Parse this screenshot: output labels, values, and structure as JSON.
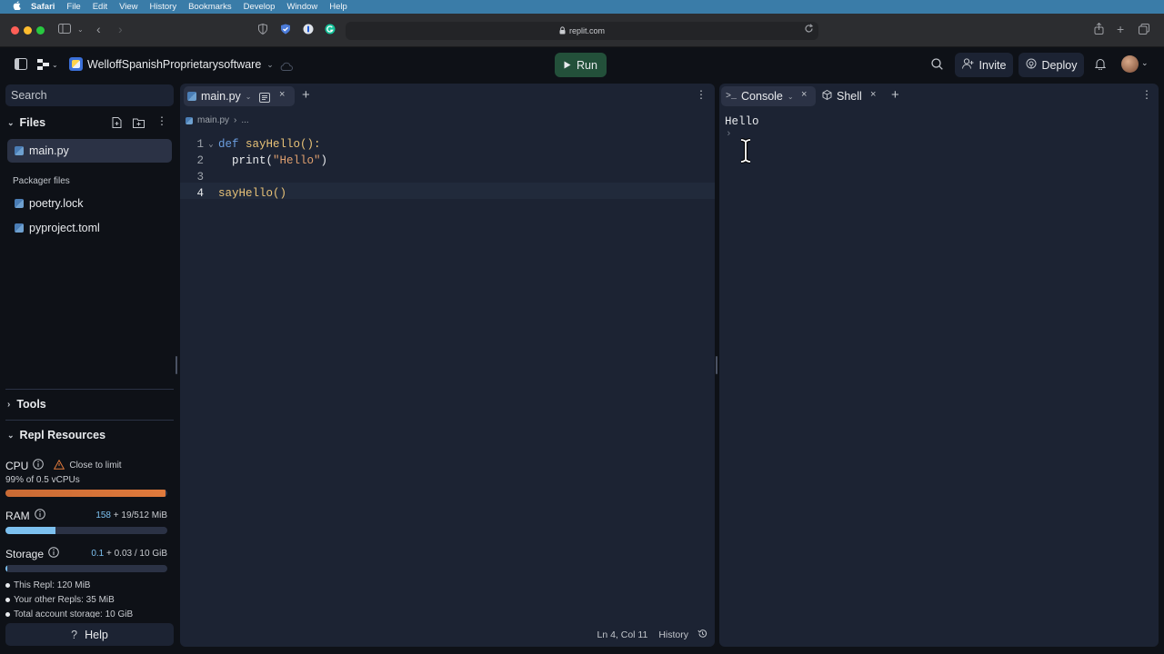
{
  "menubar": {
    "apple": "",
    "items": [
      "Safari",
      "File",
      "Edit",
      "View",
      "History",
      "Bookmarks",
      "Develop",
      "Window",
      "Help"
    ]
  },
  "browser": {
    "url": "replit.com"
  },
  "app": {
    "repl_name": "WelloffSpanishProprietarysoftware",
    "run_label": "Run",
    "invite_label": "Invite",
    "deploy_label": "Deploy"
  },
  "sidebar": {
    "search_placeholder": "Search",
    "files_title": "Files",
    "active_file": "main.py",
    "packager_title": "Packager files",
    "packager_files": [
      "poetry.lock",
      "pyproject.toml"
    ],
    "tools_title": "Tools",
    "resources_title": "Repl Resources",
    "cpu_label": "CPU",
    "cpu_warning": "Close to limit",
    "cpu_detail": "99% of 0.5 vCPUs",
    "cpu_fraction": 0.99,
    "ram_label": "RAM",
    "ram_used": "158",
    "ram_rest": "+ 19/512 MiB",
    "ram_fraction": 0.31,
    "storage_label": "Storage",
    "storage_used": "0.1",
    "storage_rest": "+ 0.03 / 10 GiB",
    "storage_fraction": 0.01,
    "storage_items": [
      "This Repl: 120 MiB",
      "Your other Repls: 35 MiB",
      "Total account storage: 10 GiB"
    ],
    "help_label": "Help"
  },
  "editor": {
    "tab_label": "main.py",
    "breadcrumb_file": "main.py",
    "breadcrumb_more": "...",
    "lines": [
      {
        "num": "1",
        "kw": "def",
        "rest": " sayHello():"
      },
      {
        "num": "2",
        "fn": "  print(",
        "str": "\"Hello\"",
        "end": ")"
      },
      {
        "num": "3",
        "text": ""
      },
      {
        "num": "4",
        "text": "sayHello()"
      }
    ],
    "status_position": "Ln 4, Col 11",
    "status_history": "History"
  },
  "console": {
    "tab_console": "Console",
    "tab_shell": "Shell",
    "output": "Hello",
    "prompt": "›"
  },
  "colors": {
    "keyword": "#6b9ee0",
    "string": "#e0a06f",
    "function": "#e8c277",
    "cpu_bar": "#e07a3c",
    "ram_bar": "#7cc0ef"
  }
}
